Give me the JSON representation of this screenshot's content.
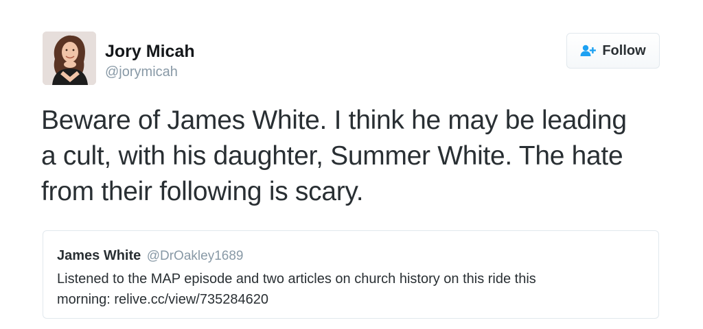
{
  "author": {
    "name": "Jory Micah",
    "handle": "@jorymicah"
  },
  "follow_button": {
    "label": "Follow",
    "icon": "add-user-icon",
    "icon_color": "#1da1f2"
  },
  "tweet": {
    "lines": [
      "Beware of James White. I think he may be leading",
      "a cult, with his daughter, Summer White. The hate",
      "from their following is scary."
    ]
  },
  "quoted_tweet": {
    "name": "James White",
    "handle": "@DrOakley1689",
    "lines": [
      "Listened to the MAP episode and two articles on church history on this ride this",
      "morning:  relive.cc/view/735284620"
    ]
  },
  "colors": {
    "text": "#292f33",
    "secondary_text": "#8899a6",
    "border": "#e1e8ed"
  }
}
